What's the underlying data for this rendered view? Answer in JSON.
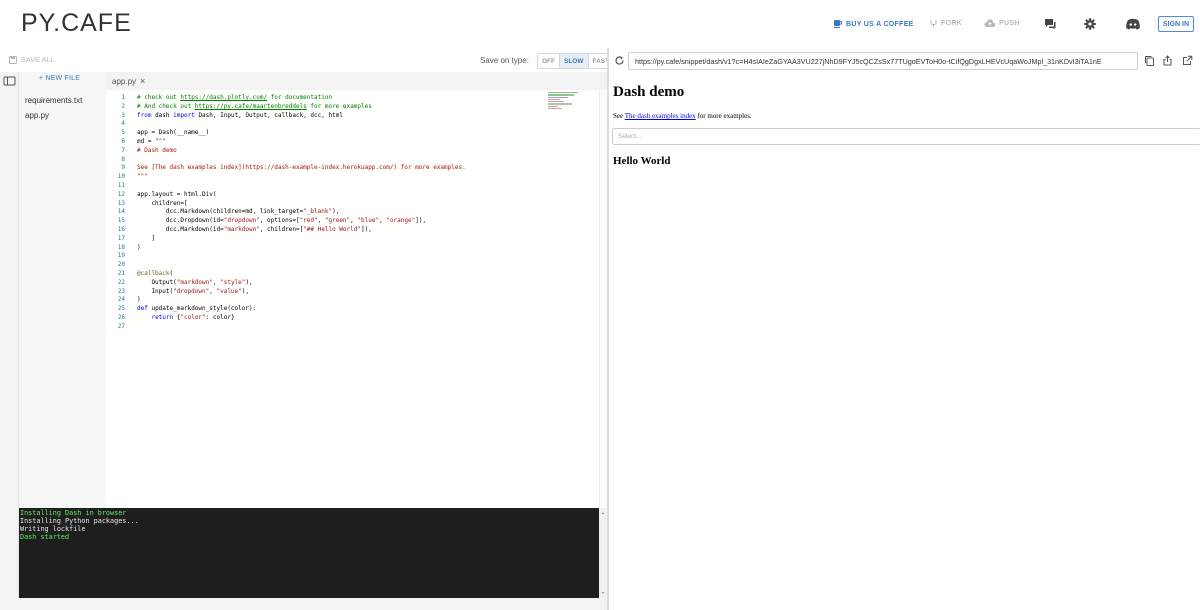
{
  "header": {
    "logo": "PY.CAFE",
    "buy_coffee": "BUY US A COFFEE",
    "fork": "FORK",
    "push": "PUSH",
    "sign_in": "SIGN IN",
    "accent_color": "#3b78c2"
  },
  "toolbar": {
    "save_all": "SAVE ALL",
    "save_on_type_label": "Save on type:",
    "save_modes": [
      "OFF",
      "SLOW",
      "FAST"
    ],
    "selected_mode": "SLOW"
  },
  "sidebar": {
    "new_file": "+ NEW FILE",
    "files": [
      "requirements.txt",
      "app.py"
    ]
  },
  "editor": {
    "active_tab": "app.py",
    "tab_close": "×",
    "line_numbers": [
      "1",
      "2",
      "3",
      "4",
      "5",
      "6",
      "7",
      "8",
      "9",
      "10",
      "11",
      "12",
      "13",
      "14",
      "15",
      "16",
      "17",
      "18",
      "19",
      "20",
      "21",
      "22",
      "23",
      "24",
      "25",
      "26",
      "27"
    ]
  },
  "console": {
    "lines": [
      {
        "text": "Installing Dash in browser",
        "color": "green"
      },
      {
        "text": "Installing Python packages...",
        "color": "white"
      },
      {
        "text": "Writing lockfile",
        "color": "white"
      },
      {
        "text": "Dash started",
        "color": "green"
      }
    ]
  },
  "browser": {
    "url": "https://py.cafe/snippet/dash/v1?c=H4sIAIeZaGYAA3VU227jNhD9FYJ5cQCZsSx77TUgoEVToH0o-tCifQgDgxLHEVcUqaWoJMpl_31nKDvI3iTA1nE"
  },
  "preview": {
    "title": "Dash demo",
    "see_prefix": "See ",
    "link_text": "The dash examples index",
    "see_suffix": " for more examples.",
    "select_placeholder": "Select...",
    "hello": "Hello World"
  }
}
